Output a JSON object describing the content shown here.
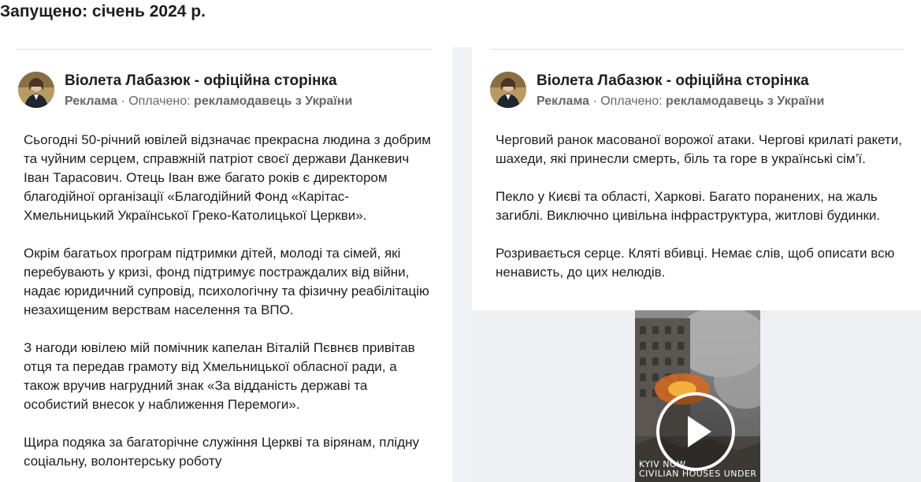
{
  "header": {
    "launched_text": "Запущено: січень 2024 р."
  },
  "ads": [
    {
      "page_name": "Віолета Лабазюк - офіційна сторінка",
      "ad_label": "Реклама",
      "separator": " · ",
      "paid_prefix": "Оплачено: ",
      "advertiser": "рекламодавець з України",
      "paragraphs": [
        "Сьогодні 50-річний ювілей відзначає прекрасна людина з добрим та чуйним серцем, справжній патріот своєї держави Данкевич Іван Тарасович. Отець Іван вже багато років є директором благодійної організації «Благодійний Фонд «Карітас-Хмельницький Української Греко-Католицької Церкви».",
        "Окрім багатьох програм підтримки дітей, молоді та сімей, які перебувають у кризі, фонд підтримує постраждалих від війни, надає юридичний супровід, психологічну та фізичну реабілітацію незахищеним верствам населення та ВПО.",
        "З нагоди ювілею мій помічник капелан Віталій Пєвнєв привітав отця та передав грамоту від Хмельницької обласної ради, а також вручив нагрудний знак «За відданість державі та особистий внесок у наближення Перемоги».",
        "Щира подяка за багаторічне служіння Церкві та вірянам, плідну соціальну, волонтерську роботу"
      ]
    },
    {
      "page_name": "Віолета Лабазюк - офіційна сторінка",
      "ad_label": "Реклама",
      "separator": " · ",
      "paid_prefix": "Оплачено: ",
      "advertiser": "рекламодавець з України",
      "paragraphs": [
        "Черговий ранок масованої ворожої атаки. Чергові крилаті ракети, шахеди, які принесли смерть, біль та горе в українські сім’ї.",
        "Пекло у Києві та області, Харкові. Багато поранених, на жаль загиблі. Виключно цивільна інфраструктура, житлові будинки.",
        "Розривається серце. Кляті вбивці. Немає слів, щоб описати всю ненависть, до цих нелюдів."
      ],
      "video": {
        "caption_line1": "KYIV NOW.",
        "caption_line2": "CIVILIAN HOUSES UNDER"
      }
    }
  ],
  "colors": {
    "page_bg": "#f0f2f5",
    "card_bg": "#ffffff",
    "secondary_text": "#65676b",
    "primary_text": "#1c1e21"
  }
}
